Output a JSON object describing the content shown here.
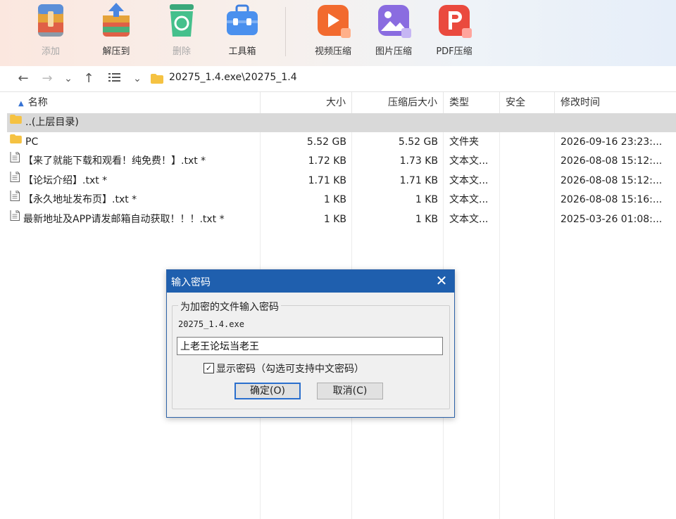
{
  "toolbar": {
    "items": [
      {
        "label": "添加",
        "icon": "archive-add-icon",
        "disabled": true
      },
      {
        "label": "解压到",
        "icon": "extract-to-icon",
        "disabled": false
      },
      {
        "label": "删除",
        "icon": "recycle-delete-icon",
        "disabled": true
      },
      {
        "label": "工具箱",
        "icon": "toolbox-icon",
        "disabled": false
      },
      {
        "label": "视频压缩",
        "icon": "video-compress-icon",
        "disabled": false
      },
      {
        "label": "图片压缩",
        "icon": "image-compress-icon",
        "disabled": false
      },
      {
        "label": "PDF压缩",
        "icon": "pdf-compress-icon",
        "disabled": false
      }
    ]
  },
  "navbar": {
    "path": "20275_1.4.exe\\20275_1.4"
  },
  "table": {
    "columns": [
      "名称",
      "大小",
      "压缩后大小",
      "类型",
      "安全",
      "修改时间"
    ],
    "rows": [
      {
        "name": "..(上层目录)",
        "size": "",
        "packed": "",
        "type": "",
        "security": "",
        "modified": "",
        "icon": "folder-icon",
        "selected": true
      },
      {
        "name": "PC",
        "size": "5.52 GB",
        "packed": "5.52 GB",
        "type": "文件夹",
        "security": "",
        "modified": "2026-09-16 23:23:...",
        "icon": "folder-icon",
        "selected": false
      },
      {
        "name": "【来了就能下载和观看！纯免费！】.txt *",
        "size": "1.72 KB",
        "packed": "1.73 KB",
        "type": "文本文...",
        "security": "",
        "modified": "2026-08-08 15:12:...",
        "icon": "text-file-icon",
        "selected": false
      },
      {
        "name": "【论坛介绍】.txt *",
        "size": "1.71 KB",
        "packed": "1.71 KB",
        "type": "文本文...",
        "security": "",
        "modified": "2026-08-08 15:12:...",
        "icon": "text-file-icon",
        "selected": false
      },
      {
        "name": "【永久地址发布页】.txt *",
        "size": "1 KB",
        "packed": "1 KB",
        "type": "文本文...",
        "security": "",
        "modified": "2026-08-08 15:16:...",
        "icon": "text-file-icon",
        "selected": false
      },
      {
        "name": "最新地址及APP请发邮箱自动获取！！！.txt *",
        "size": "1 KB",
        "packed": "1 KB",
        "type": "文本文...",
        "security": "",
        "modified": "2025-03-26 01:08:...",
        "icon": "text-file-icon",
        "selected": false
      }
    ]
  },
  "dialog": {
    "title": "输入密码",
    "group_label": "为加密的文件输入密码",
    "filename": "20275_1.4.exe",
    "password_value": "上老王论坛当老王",
    "show_password_label": "显示密码（勾选可支持中文密码）",
    "show_password_checked": true,
    "ok_label": "确定(O)",
    "cancel_label": "取消(C)"
  },
  "colors": {
    "dialog_title_bg": "#1f5fae",
    "selected_row_bg": "#d9d9d9",
    "folder_yellow": "#f5c242"
  }
}
